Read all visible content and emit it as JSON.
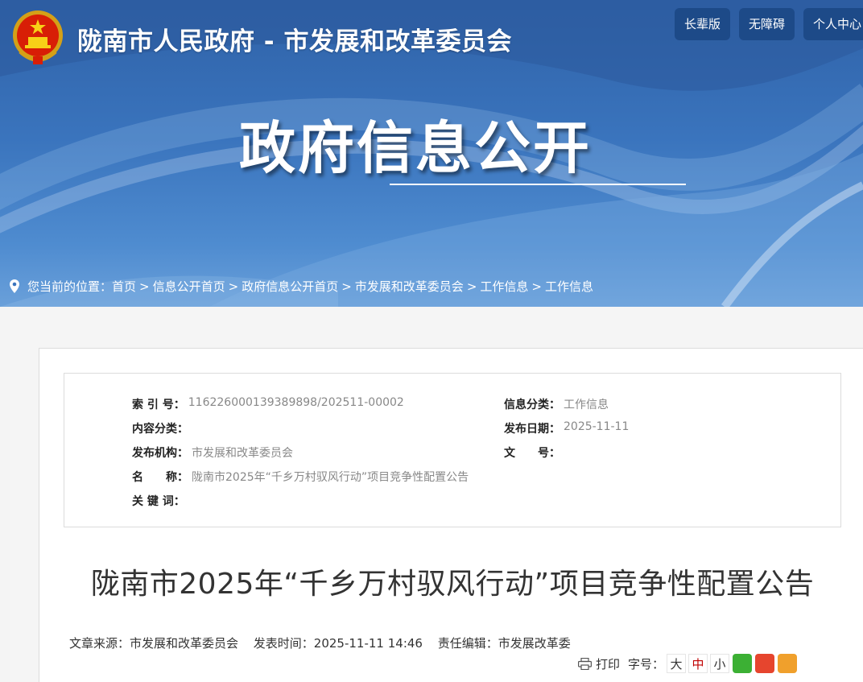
{
  "header": {
    "site_title": "陇南市人民政府 - 市发展和改革委员会",
    "buttons": [
      "长辈版",
      "无障碍",
      "个人中心"
    ],
    "hero_title": "政府信息公开"
  },
  "breadcrumb": {
    "prefix": "您当前的位置：",
    "items": [
      "首页",
      "信息公开首页",
      "政府信息公开首页",
      "市发展和改革委员会",
      "工作信息",
      "工作信息"
    ]
  },
  "meta": {
    "index_no_label": "索 引 号：",
    "index_no": "116226000139389898/202511-00002",
    "category_label": "信息分类：",
    "category": "工作信息",
    "content_type_label": "内容分类：",
    "content_type": "",
    "publish_date_label": "发布日期：",
    "publish_date": "2025-11-11",
    "publisher_label": "发布机构：",
    "publisher": "市发展和改革委员会",
    "doc_no_label": "文　　号：",
    "doc_no": "",
    "name_label": "名　　称：",
    "name": "陇南市2025年“千乡万村驭风行动”项目竞争性配置公告",
    "keywords_label": "关 键 词：",
    "keywords": ""
  },
  "article": {
    "title": "陇南市2025年“千乡万村驭风行动”项目竞争性配置公告",
    "source": "文章来源：市发展和改革委员会",
    "time": "发表时间：2025-11-11 14:46",
    "editor": "责任编辑：市发展改革委"
  },
  "tools": {
    "print": "打印",
    "font_size_label": "字号：",
    "sizes": [
      "大",
      "中",
      "小"
    ],
    "share_icons": [
      "wechat-icon",
      "weibo-icon",
      "qzone-icon"
    ]
  },
  "colors": {
    "banner": "#3a74bd",
    "button": "#1d4a88",
    "active_size": "#c00000"
  }
}
